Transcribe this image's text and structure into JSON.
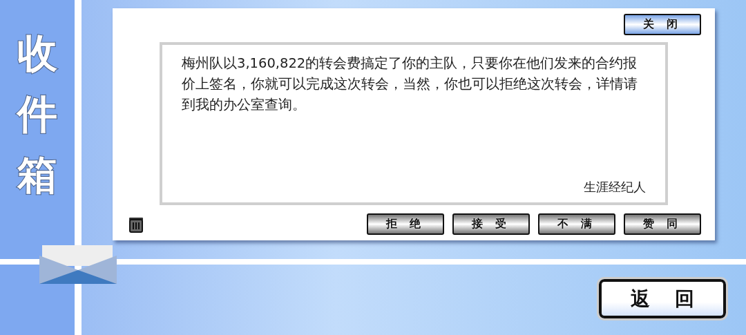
{
  "sidebar": {
    "title": "收件箱"
  },
  "message": {
    "close_button": "关闭",
    "body": "梅州队以3,160,822的转会费搞定了你的主队，只要你在他们发来的合约报价上签名，你就可以完成这次转会，当然，你也可以拒绝这次转会，详情请到我的办公室查询。",
    "signature": "生涯经纪人",
    "actions": [
      "拒绝",
      "接受",
      "不满",
      "赞同"
    ]
  },
  "back_button": "返回"
}
